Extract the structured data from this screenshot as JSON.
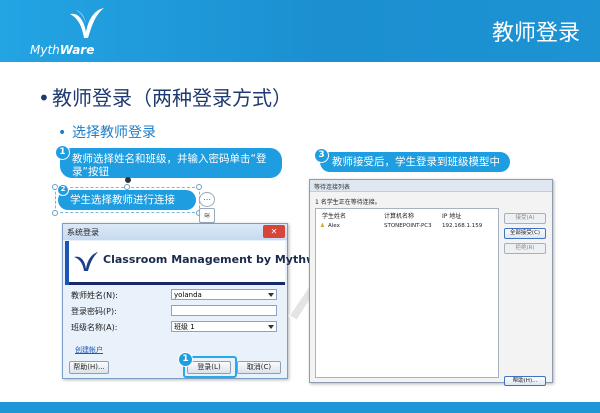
{
  "header": {
    "logo_text_1": "Myth",
    "logo_text_2": "Ware",
    "title": "教师登录"
  },
  "heading": "教师登录（两种登录方式）",
  "subheading": "选择教师登录",
  "callouts": {
    "c1_num": "1",
    "c1_text": "教师选择姓名和班级，并输入密码单击“登录”按钮",
    "c2_num": "2",
    "c2_text": "学生选择教师进行连接",
    "c3_num": "3",
    "c3_text": "教师接受后，学生登录到班级模型中",
    "login_num": "1"
  },
  "login_dialog": {
    "title": "系统登录",
    "close": "✕",
    "banner": "Classroom Management by Mythware",
    "name_label": "教师姓名(N):",
    "name_value": "yolanda",
    "password_label": "登录密码(P):",
    "password_value": "",
    "class_label": "班级名称(A):",
    "class_value": "班级 1",
    "create_link": "创建帐户",
    "help_button": "帮助(H)...",
    "login_button": "登录(L)",
    "cancel_button": "取消(C)"
  },
  "waiting_list": {
    "title": "等待连接列表",
    "info": "1 名学生正在等待连接。",
    "columns": [
      "学生姓名",
      "计算机名称",
      "IP 地址"
    ],
    "rows": [
      {
        "name": "Alex",
        "computer": "STONEPOINT-PC3",
        "ip": "192.168.1.159"
      }
    ],
    "buttons": {
      "accept": "接受(A)",
      "accept_all": "全部接受(C)",
      "reject": "拒绝(R)",
      "help": "帮助(H)..."
    }
  },
  "colors": {
    "brand_blue": "#1e9de0",
    "heading_navy": "#1f3a70"
  }
}
